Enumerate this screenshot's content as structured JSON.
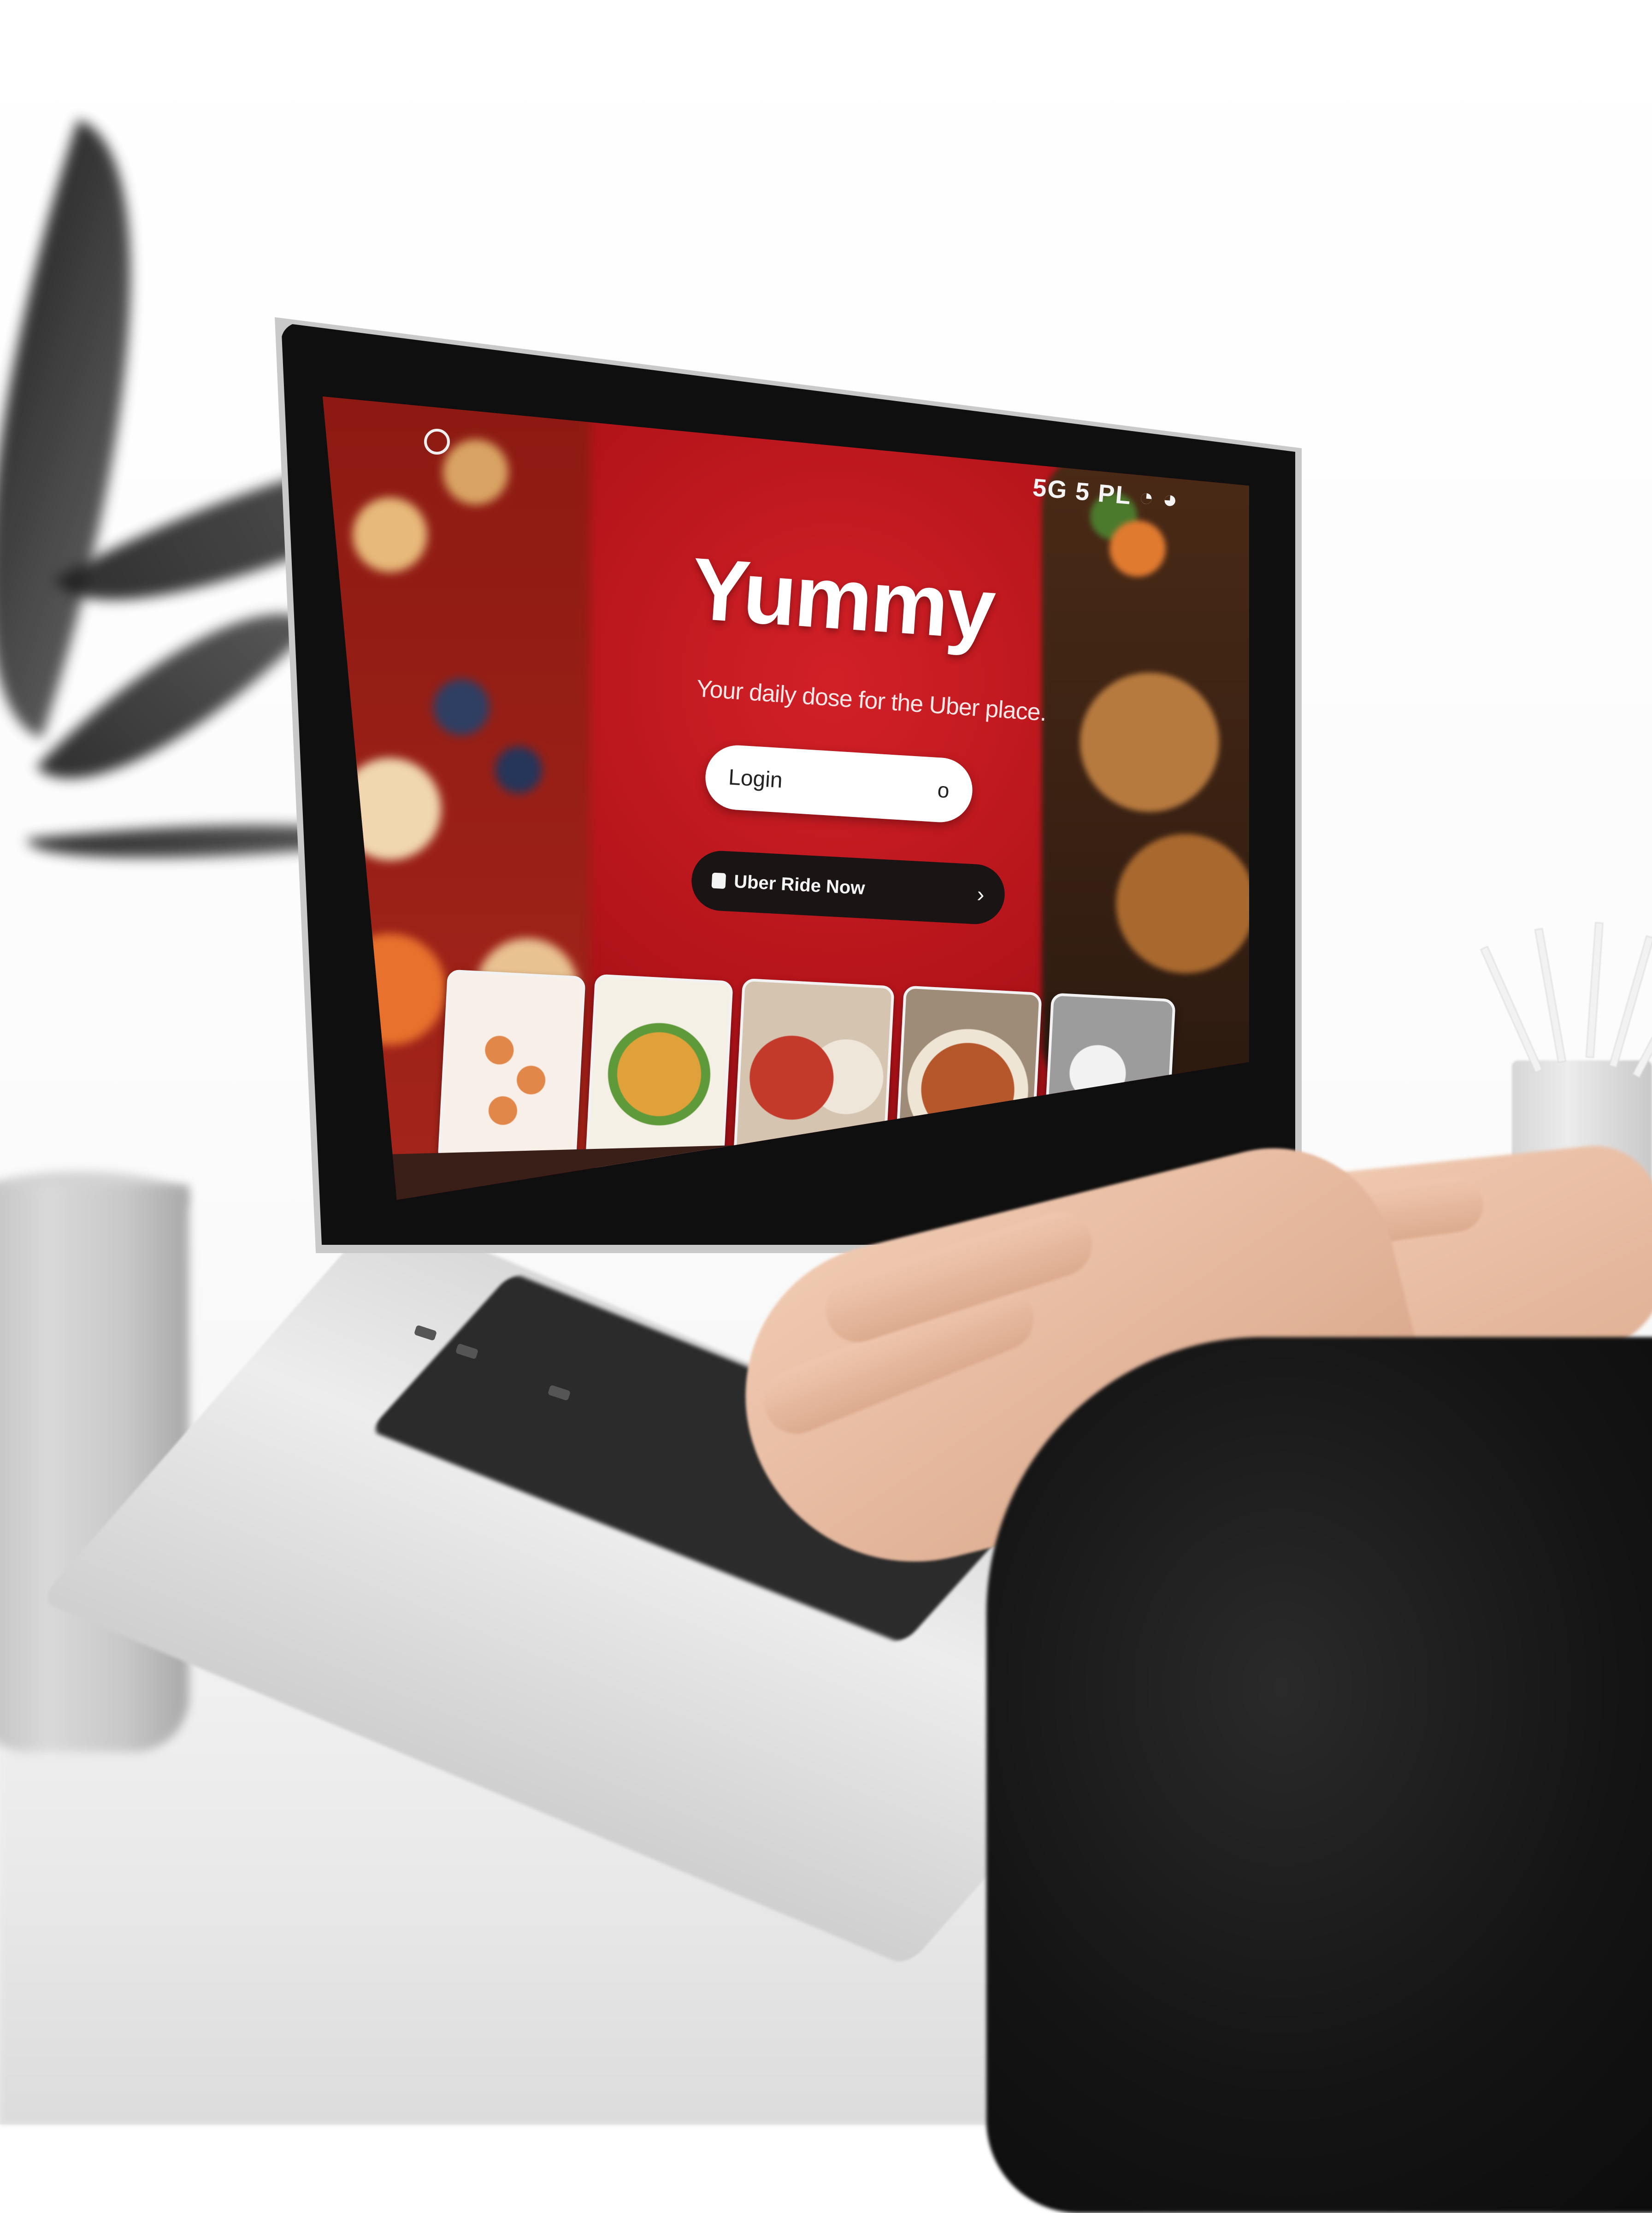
{
  "screen": {
    "brand": "Yummy",
    "tagline": "Your daily dose for the Uber place.",
    "login_label": "Login",
    "login_icon": "o",
    "dark_button_label": "Uber Ride Now",
    "dark_button_chevron": "›",
    "status_text": "5G 5 PL ◔ ◕",
    "nav_icons": [
      "◁",
      "▢",
      "⌕",
      "◎",
      "▷",
      "◌",
      "⌂"
    ]
  },
  "food_thumbs": [
    {
      "name": "almond-plate",
      "colors": [
        "#f7efe8",
        "#e2874a"
      ]
    },
    {
      "name": "salad-plate",
      "colors": [
        "#f5f0e6",
        "#e0a03a"
      ]
    },
    {
      "name": "tomato-bowl",
      "colors": [
        "#d4c4b0",
        "#c43a2a"
      ]
    },
    {
      "name": "pasta-bowl",
      "colors": [
        "#efe5d5",
        "#b5572a"
      ]
    },
    {
      "name": "rice-balls",
      "colors": [
        "#9c9c9c",
        "#f2f2f2"
      ]
    }
  ],
  "colors": {
    "screen_red": "#b3141a",
    "accent_dark": "#1a1414"
  }
}
